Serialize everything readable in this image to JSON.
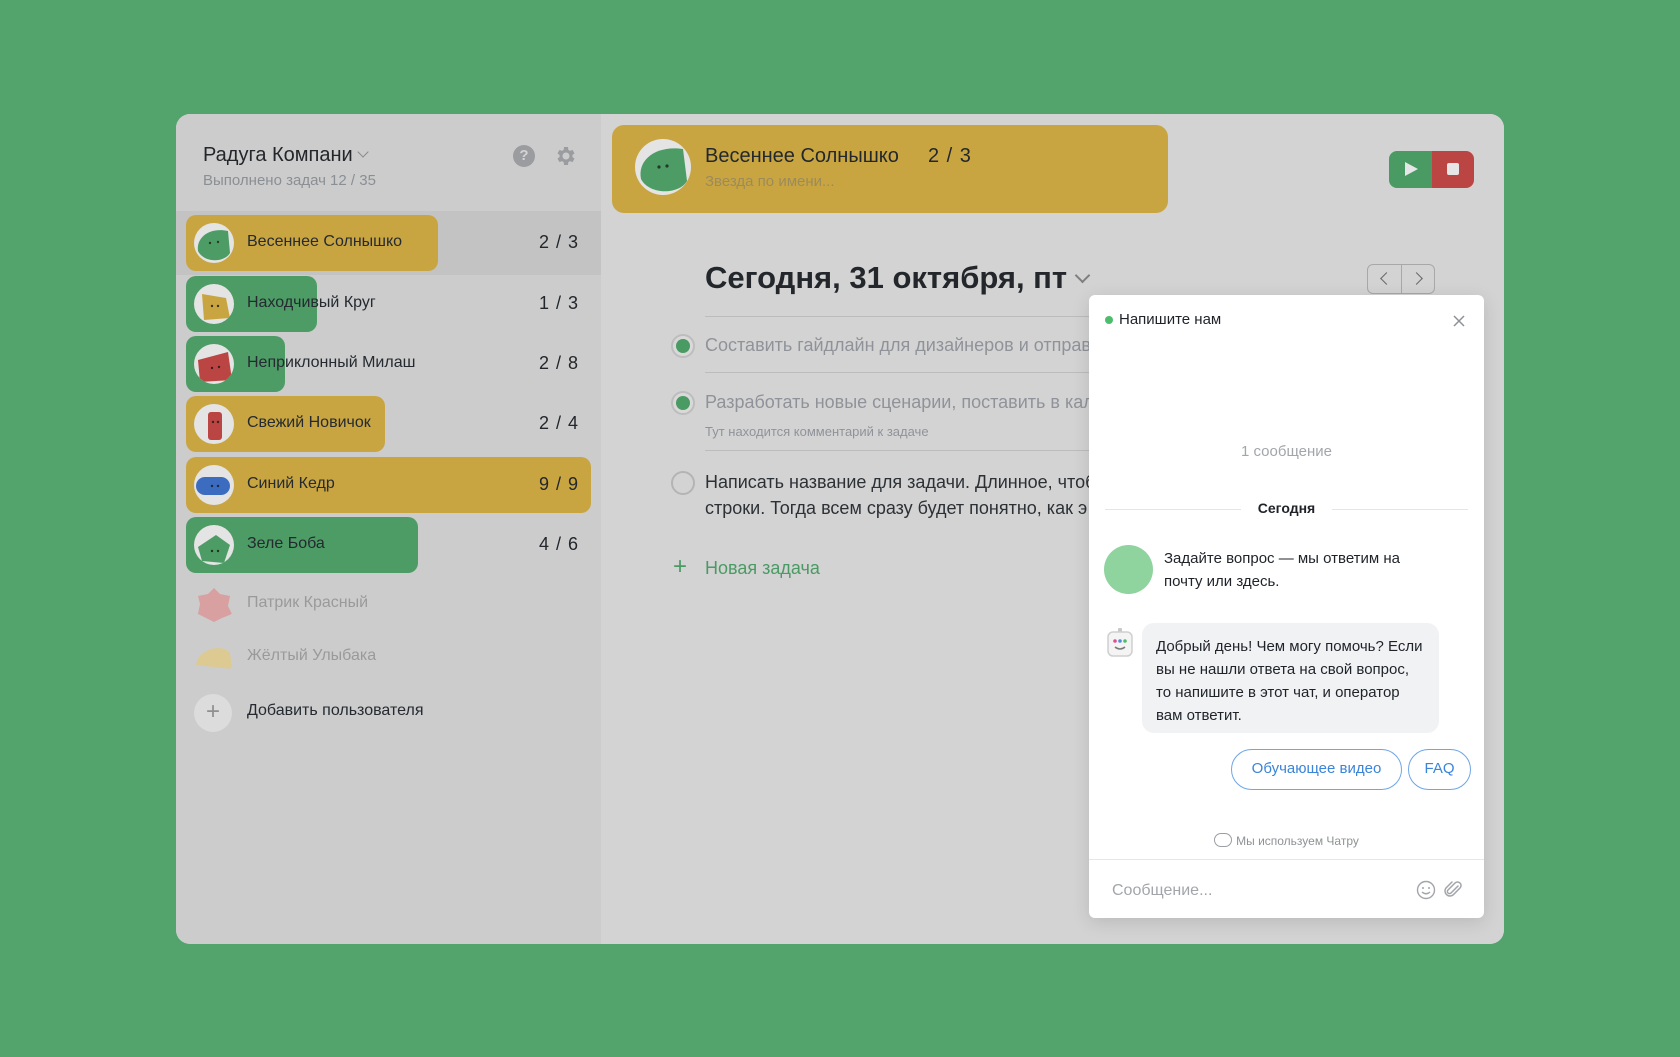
{
  "sidebar": {
    "company": "Радуга Компани",
    "tasks_done": "Выполнено задач 12 / 35",
    "users": [
      {
        "name": "Весеннее Солнышко",
        "count": "2 / 3",
        "color": "#c9a542",
        "avatar_color": "#4d9c65"
      },
      {
        "name": "Находчивый Круг",
        "count": "1 / 3",
        "color": "#4d9c65",
        "avatar_color": "#c9a542"
      },
      {
        "name": "Неприклонный Милаш",
        "count": "2 / 8",
        "color": "#4d9c65",
        "avatar_color": "#bb4542"
      },
      {
        "name": "Свежий Новичок",
        "count": "2 / 4",
        "color": "#c9a542",
        "avatar_color": "#bb4542"
      },
      {
        "name": "Синий Кедр",
        "count": "9 / 9",
        "color": "#c9a542",
        "avatar_color": "#3c6cc0"
      },
      {
        "name": "Зеле Боба",
        "count": "4 / 6",
        "color": "#4d9c65",
        "avatar_color": "#4d9c65"
      }
    ],
    "inactive_users": [
      {
        "name": "Патрик Красный"
      },
      {
        "name": "Жёлтый Улыбака"
      }
    ],
    "add_user": "Добавить пользователя"
  },
  "header": {
    "name": "Весеннее Солнышко",
    "count": "2 / 3",
    "subtitle": "Звезда по имени..."
  },
  "main": {
    "date": "Сегодня, 31 октября, пт",
    "tasks": [
      {
        "text": "Составить гайдлайн для дизайнеров и отправи",
        "done": true
      },
      {
        "text": "Разработать новые сценарии, поставить в кал",
        "done": true,
        "comment": "Тут находится комментарий к задаче"
      },
      {
        "text_line1": "Написать название для задачи. Длинное, чтоб",
        "text_line2": "строки. Тогда всем сразу будет понятно, как э",
        "done": false
      }
    ],
    "new_task": "Новая задача"
  },
  "chat": {
    "title": "Напишите нам",
    "message_count": "1 сообщение",
    "day": "Сегодня",
    "intro": "Задайте вопрос — мы ответим на почту или здесь.",
    "bot_message": "Добрый день! Чем могу помочь? Если вы не нашли ответа на свой вопрос, то напишите в этот чат, и оператор вам ответит.",
    "quick_replies": [
      "Обучающее видео",
      "FAQ"
    ],
    "powered_by": "Мы используем Чатру",
    "input_placeholder": "Сообщение..."
  }
}
